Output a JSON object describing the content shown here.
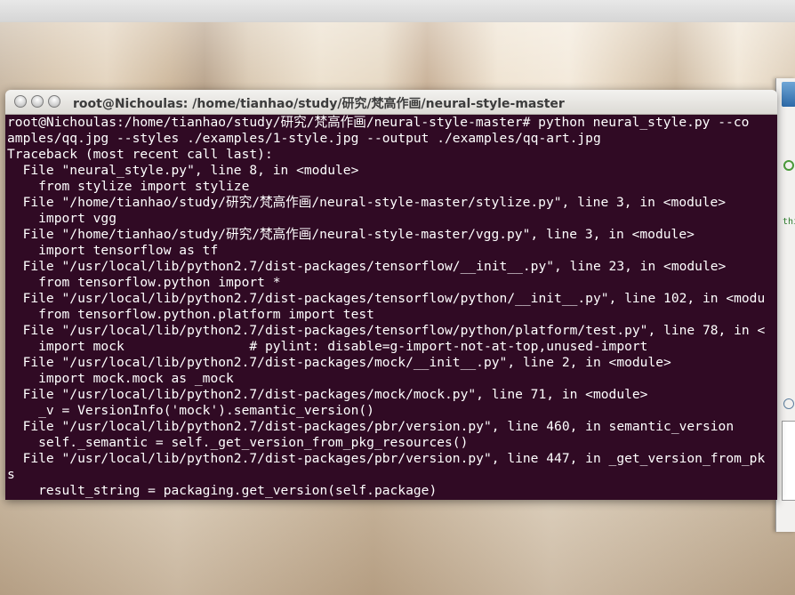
{
  "terminal": {
    "title": "root@Nichoulas: /home/tianhao/study/研究/梵高作画/neural-style-master",
    "lines": [
      "root@Nichoulas:/home/tianhao/study/研究/梵高作画/neural-style-master# python neural_style.py --co",
      "amples/qq.jpg --styles ./examples/1-style.jpg --output ./examples/qq-art.jpg",
      "Traceback (most recent call last):",
      "  File \"neural_style.py\", line 8, in <module>",
      "    from stylize import stylize",
      "  File \"/home/tianhao/study/研究/梵高作画/neural-style-master/stylize.py\", line 3, in <module>",
      "    import vgg",
      "  File \"/home/tianhao/study/研究/梵高作画/neural-style-master/vgg.py\", line 3, in <module>",
      "    import tensorflow as tf",
      "  File \"/usr/local/lib/python2.7/dist-packages/tensorflow/__init__.py\", line 23, in <module>",
      "    from tensorflow.python import *",
      "  File \"/usr/local/lib/python2.7/dist-packages/tensorflow/python/__init__.py\", line 102, in <modu",
      "    from tensorflow.python.platform import test",
      "  File \"/usr/local/lib/python2.7/dist-packages/tensorflow/python/platform/test.py\", line 78, in <",
      "    import mock                # pylint: disable=g-import-not-at-top,unused-import",
      "  File \"/usr/local/lib/python2.7/dist-packages/mock/__init__.py\", line 2, in <module>",
      "    import mock.mock as _mock",
      "  File \"/usr/local/lib/python2.7/dist-packages/mock/mock.py\", line 71, in <module>",
      "    _v = VersionInfo('mock').semantic_version()",
      "  File \"/usr/local/lib/python2.7/dist-packages/pbr/version.py\", line 460, in semantic_version",
      "    self._semantic = self._get_version_from_pkg_resources()",
      "  File \"/usr/local/lib/python2.7/dist-packages/pbr/version.py\", line 447, in _get_version_from_pk",
      "s",
      "    result_string = packaging.get_version(self.package)"
    ]
  },
  "side_window": {
    "text": "thi"
  },
  "colors": {
    "terminal_bg": "#300a24",
    "terminal_fg": "#ffffff"
  }
}
